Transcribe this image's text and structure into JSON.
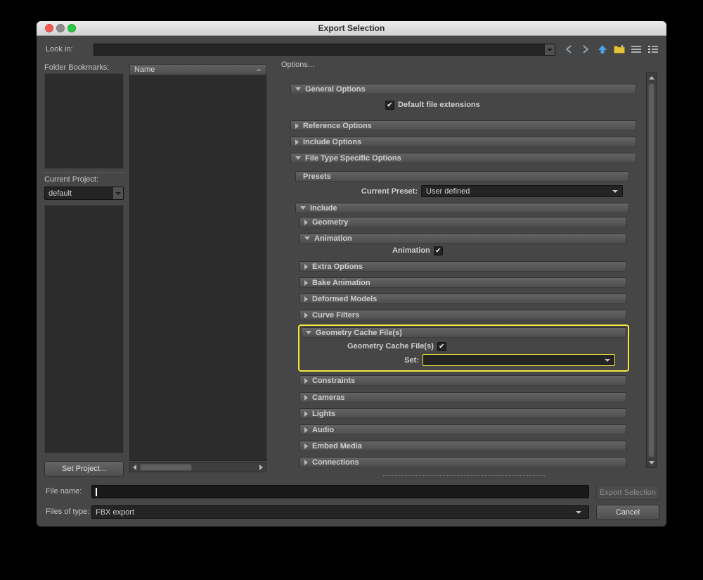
{
  "window": {
    "title": "Export Selection"
  },
  "toolbar": {
    "look_in_label": "Look in:",
    "look_in_value": "",
    "nav_icons": [
      "go-back",
      "go-forward",
      "up-one-directory",
      "create-new-folder",
      "list-view",
      "details-view"
    ]
  },
  "left_panel": {
    "folder_bookmarks_label": "Folder Bookmarks:",
    "current_project_label": "Current Project:",
    "current_project_value": "default",
    "set_project_button": "Set Project..."
  },
  "file_list": {
    "name_column_header": "Name"
  },
  "options": {
    "label": "Options...",
    "rows": [
      {
        "type": "section",
        "key": "general-options",
        "label": "General Options",
        "expanded": true,
        "indent": 0
      },
      {
        "type": "checkbox",
        "key": "default-file-extensions",
        "label": "Default file extensions",
        "checked": true,
        "label_position": "after"
      },
      {
        "type": "section",
        "key": "reference-options",
        "label": "Reference Options",
        "expanded": false,
        "indent": 0
      },
      {
        "type": "section",
        "key": "include-options",
        "label": "Include Options",
        "expanded": false,
        "indent": 0
      },
      {
        "type": "section",
        "key": "file-type-specific-options",
        "label": "File Type Specific Options",
        "expanded": true,
        "indent": 0
      },
      {
        "type": "header",
        "key": "presets",
        "label": "Presets",
        "indent": 1
      },
      {
        "type": "dropdown",
        "key": "current-preset",
        "label": "Current Preset:",
        "value": "User defined",
        "highlighted": false
      },
      {
        "type": "section",
        "key": "include",
        "label": "Include",
        "expanded": true,
        "indent": 1
      },
      {
        "type": "section",
        "key": "geometry",
        "label": "Geometry",
        "expanded": false,
        "indent": 2
      },
      {
        "type": "section",
        "key": "animation",
        "label": "Animation",
        "expanded": true,
        "indent": 2
      },
      {
        "type": "checkbox",
        "key": "animation-checkbox",
        "label": "Animation",
        "checked": true,
        "label_position": "before"
      },
      {
        "type": "section",
        "key": "extra-options",
        "label": "Extra Options",
        "expanded": false,
        "indent": 2
      },
      {
        "type": "section",
        "key": "bake-animation",
        "label": "Bake Animation",
        "expanded": false,
        "indent": 2
      },
      {
        "type": "section",
        "key": "deformed-models",
        "label": "Deformed Models",
        "expanded": false,
        "indent": 2
      },
      {
        "type": "section",
        "key": "curve-filters",
        "label": "Curve Filters",
        "expanded": false,
        "indent": 2
      },
      {
        "type": "group",
        "key": "geometry-cache-group",
        "highlighted": true,
        "children": [
          {
            "type": "section",
            "key": "geometry-cache-files",
            "label": "Geometry Cache File(s)",
            "expanded": true,
            "indent": -1
          },
          {
            "type": "checkbox",
            "key": "geometry-cache-files-checkbox",
            "label": "Geometry Cache File(s)",
            "checked": true,
            "label_position": "before"
          },
          {
            "type": "dropdown",
            "key": "set",
            "label": "Set:",
            "value": "",
            "highlighted": true
          }
        ]
      },
      {
        "type": "section",
        "key": "constraints",
        "label": "Constraints",
        "expanded": false,
        "indent": 2
      },
      {
        "type": "section",
        "key": "cameras",
        "label": "Cameras",
        "expanded": false,
        "indent": 2
      },
      {
        "type": "section",
        "key": "lights",
        "label": "Lights",
        "expanded": false,
        "indent": 2
      },
      {
        "type": "section",
        "key": "audio",
        "label": "Audio",
        "expanded": false,
        "indent": 2
      },
      {
        "type": "section",
        "key": "embed-media",
        "label": "Embed Media",
        "expanded": false,
        "indent": 2
      },
      {
        "type": "section",
        "key": "connections",
        "label": "Connections",
        "expanded": false,
        "indent": 2
      }
    ]
  },
  "footer": {
    "file_name_label": "File name:",
    "file_name_value": "",
    "export_button": "Export Selection",
    "export_button_enabled": false,
    "files_of_type_label": "Files of type:",
    "files_of_type_value": "FBX export",
    "cancel_button": "Cancel"
  },
  "colors": {
    "highlight_outline": "#efe93f",
    "window_background": "#464646",
    "field_background": "#242424",
    "up_arrow_icon_color": "#4aa3e0",
    "new_folder_icon_color": "#e6c23a"
  }
}
